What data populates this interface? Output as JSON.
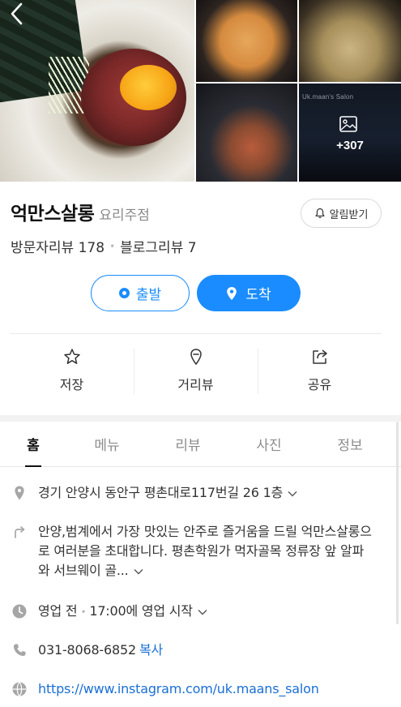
{
  "place": {
    "name": "억만스살롱",
    "category": "요리주점",
    "alert_label": "알림받기",
    "visitor_reviews": "방문자리뷰 178",
    "blog_reviews": "블로그리뷰 7"
  },
  "gallery": {
    "sign_text": "Uk.maan's Salon",
    "more_count": "+307"
  },
  "route": {
    "start_label": "출발",
    "arrive_label": "도착",
    "accent_color": "#1a8cff"
  },
  "actions": [
    {
      "label": "저장",
      "icon": "star-icon"
    },
    {
      "label": "거리뷰",
      "icon": "street-view-icon"
    },
    {
      "label": "공유",
      "icon": "share-icon"
    }
  ],
  "tabs": [
    "홈",
    "메뉴",
    "리뷰",
    "사진",
    "정보"
  ],
  "active_tab": "홈",
  "info": {
    "address": "경기 안양시 동안구 평촌대로117번길 26 1층",
    "description": "안양,범계에서 가장 맛있는 안주로 즐거움을 드릴 억만스살롱으로 여러분을 초대합니다. 평촌학원가 먹자골목 정류장 앞 알파와 서브웨이 골...",
    "hours_status": "영업 전",
    "hours_open": "17:00에 영업 시작",
    "phone": "031-8068-6852",
    "copy_label": "복사",
    "website": "https://www.instagram.com/uk.maans_salon"
  }
}
